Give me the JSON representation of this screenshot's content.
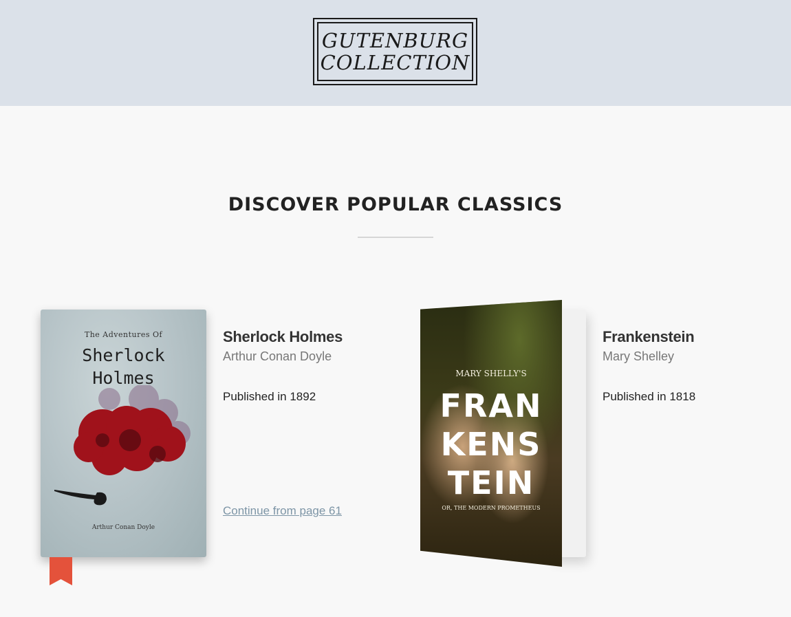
{
  "header": {
    "logo_line1": "GUTENBURG",
    "logo_line2": "COLLECTION",
    "background": "#dbe1e9"
  },
  "section": {
    "title": "DISCOVER POPULAR CLASSICS"
  },
  "books": [
    {
      "title": "Sherlock Holmes",
      "author": "Arthur Conan Doyle",
      "published": "Published in 1892",
      "continue_link": "Continue from page 61",
      "bookmarked": true,
      "cover": {
        "top_text": "The Adventures Of",
        "title_line1": "Sherlock",
        "title_line2": "Holmes",
        "author": "Arthur Conan Doyle"
      }
    },
    {
      "title": "Frankenstein",
      "author": "Mary Shelley",
      "published": "Published in 1818",
      "cover": {
        "subtitle": "MARY SHELLY'S",
        "title_line1": "FRAN",
        "title_line2": "KENS",
        "title_line3": "TEIN",
        "footer": "OR, THE MODERN PROMETHEUS"
      }
    }
  ],
  "colors": {
    "accent_bookmark": "#e4523b",
    "link": "#7d95a6"
  }
}
